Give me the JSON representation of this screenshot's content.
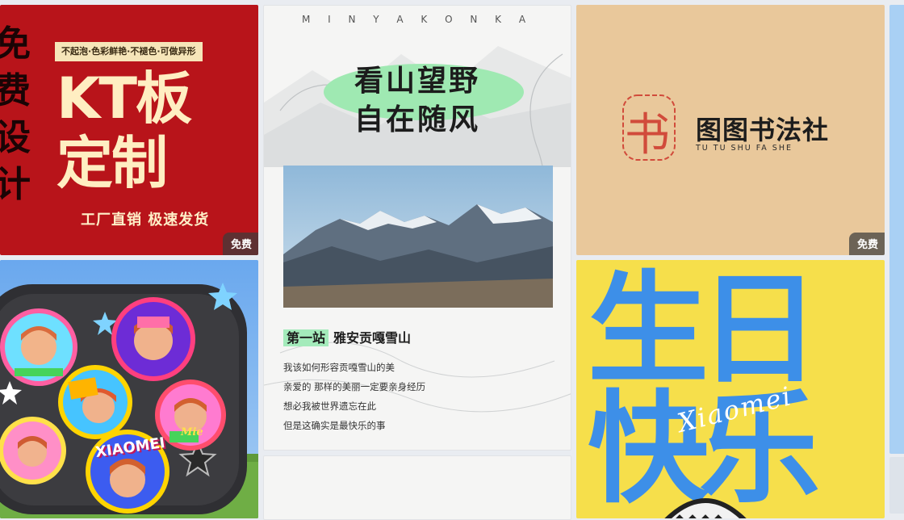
{
  "cards": {
    "kt": {
      "left_col": [
        "免",
        "费",
        "设",
        "计"
      ],
      "top_strip": "不起泡·色彩鲜艳·不褪色·可做异形",
      "title_line1": "KT板",
      "title_line2": "定制",
      "footer": "工厂直销  极速发货",
      "badge": "免费"
    },
    "mountain": {
      "header": "M I N Y A   K O N K A",
      "headline1": "看山望野",
      "headline2": "自在随风",
      "station_label": "第一站",
      "station_name": "雅安贡嘎雪山",
      "verses": [
        "我该如何形容贡嘎雪山的美",
        "亲爱的 那样的美丽一定要亲身经历",
        "想必我被世界遗忘在此",
        "但是这确实是最快乐的事"
      ]
    },
    "calligraphy": {
      "seal_char": "书",
      "name": "图图书法社",
      "pinyin": "TU TU SHU FA SHE",
      "badge": "免费"
    },
    "birthday": {
      "line1": "生日",
      "line2": "快乐",
      "script": "Xiaomei"
    },
    "pins": {
      "labels": [
        "XIAOMEI",
        "Mie"
      ]
    }
  },
  "colors": {
    "kt_red": "#b8141a",
    "cream": "#ffeec2",
    "mint": "#9fe9b2",
    "tan": "#e9c89b",
    "yellow": "#f6df4b",
    "blue": "#3d8fe8"
  }
}
